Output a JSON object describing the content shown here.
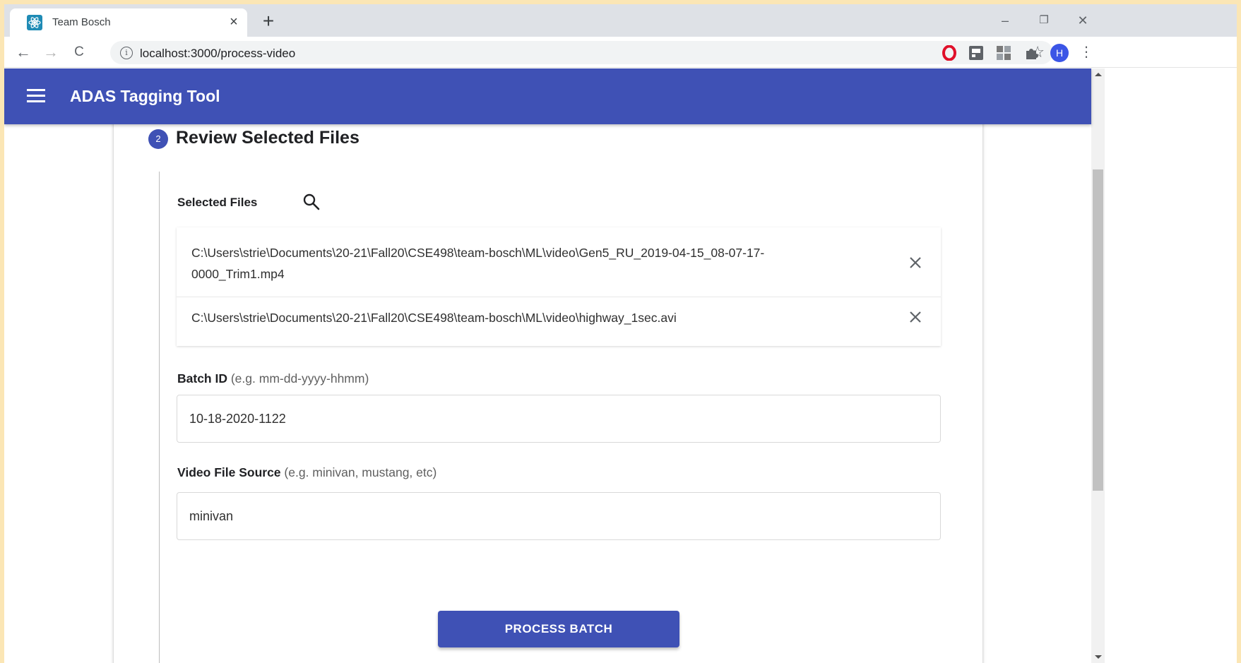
{
  "browser": {
    "tab": {
      "title": "Team Bosch",
      "close_glyph": "×"
    },
    "new_tab_glyph": "+",
    "window_controls": {
      "minimize": "–",
      "restore": "❐",
      "close": "✕"
    },
    "nav": {
      "back": "←",
      "forward": "→",
      "reload": "C"
    },
    "address": {
      "info_glyph": "i",
      "url": "localhost:3000/process-video",
      "star_glyph": "☆"
    },
    "profile_initial": "H",
    "menu_glyph": "⋮",
    "colors": {
      "opera": "#e0102a",
      "profile": "#3b55e6"
    }
  },
  "appbar": {
    "title": "ADAS Tagging Tool",
    "color": "#3f51b5"
  },
  "step": {
    "number": "2",
    "title": "Review Selected Files"
  },
  "selected_files": {
    "label": "Selected Files",
    "files": [
      {
        "path_line1": "C:\\Users\\strie\\Documents\\20-21\\Fall20\\CSE498\\team-bosch\\ML\\video\\Gen5_RU_2019-04-15_08-07-17-",
        "path_line2": "0000_Trim1.mp4"
      },
      {
        "path_line1": "C:\\Users\\strie\\Documents\\20-21\\Fall20\\CSE498\\team-bosch\\ML\\video\\highway_1sec.avi",
        "path_line2": ""
      }
    ]
  },
  "batch_id": {
    "label": "Batch ID",
    "hint": "(e.g. mm-dd-yyyy-hhmm)",
    "value": "10-18-2020-1122"
  },
  "video_source": {
    "label": "Video File Source",
    "hint": "(e.g. minivan, mustang, etc)",
    "value": "minivan"
  },
  "process_button": {
    "label": "PROCESS BATCH"
  }
}
